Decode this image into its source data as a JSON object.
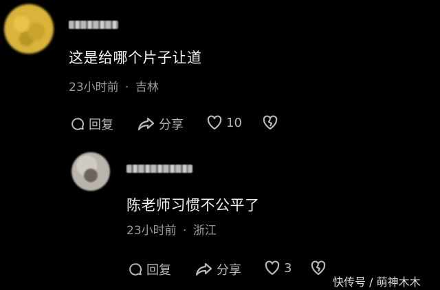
{
  "comments": [
    {
      "text": "这是给哪个片子让道",
      "meta": {
        "time": "23小时前",
        "separator": "·",
        "location": "吉林"
      },
      "actions": {
        "reply": "回复",
        "share": "分享",
        "likes": "10"
      }
    },
    {
      "text": "陈老师习惯不公平了",
      "meta": {
        "time": "23小时前",
        "separator": "·",
        "location": "浙江"
      },
      "actions": {
        "reply": "回复",
        "share": "分享",
        "likes": "3"
      }
    }
  ],
  "watermark": "快传号 / 萌神木木"
}
